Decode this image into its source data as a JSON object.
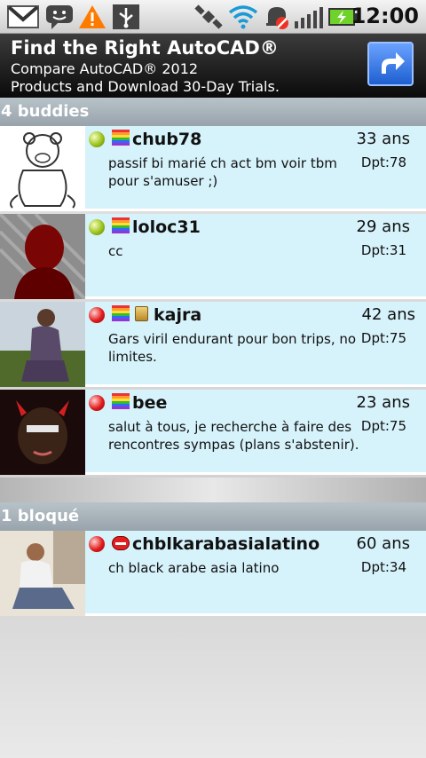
{
  "status_bar": {
    "time": "12:00",
    "icons": [
      "gmail-icon",
      "chat-icon",
      "warning-icon",
      "usb-icon",
      "satellite-gps-icon",
      "wifi-icon",
      "mute-alarm-icon",
      "signal-icon",
      "battery-charging-icon"
    ]
  },
  "ad": {
    "title": "Find the Right AutoCAD®",
    "line1": "Compare AutoCAD® 2012",
    "line2": "Products and Download 30-Day Trials."
  },
  "sections": {
    "buddies_header": "4 buddies",
    "blocked_header": "1 bloqué"
  },
  "buddies": [
    {
      "name": "chub78",
      "age": "33 ans",
      "desc": "passif bi marié ch act bm voir tbm pour s'amuser ;)",
      "dept": "Dpt:78",
      "status": "green"
    },
    {
      "name": "loloc31",
      "age": "29 ans",
      "desc": "cc",
      "dept": "Dpt:31",
      "status": "green"
    },
    {
      "name": "kajra",
      "age": "42 ans",
      "desc": "Gars viril endurant pour bon trips, no limites.",
      "dept": "Dpt:75",
      "status": "red"
    },
    {
      "name": "bee",
      "age": "23 ans",
      "desc": "salut à tous, je recherche à faire des rencontres sympas (plans s'abstenir).",
      "dept": "Dpt:75",
      "status": "red"
    }
  ],
  "blocked": [
    {
      "name": "chblkarabasialatino",
      "age": "60 ans",
      "desc": "ch black arabe asia latino",
      "dept": "Dpt:34",
      "status": "red"
    }
  ]
}
